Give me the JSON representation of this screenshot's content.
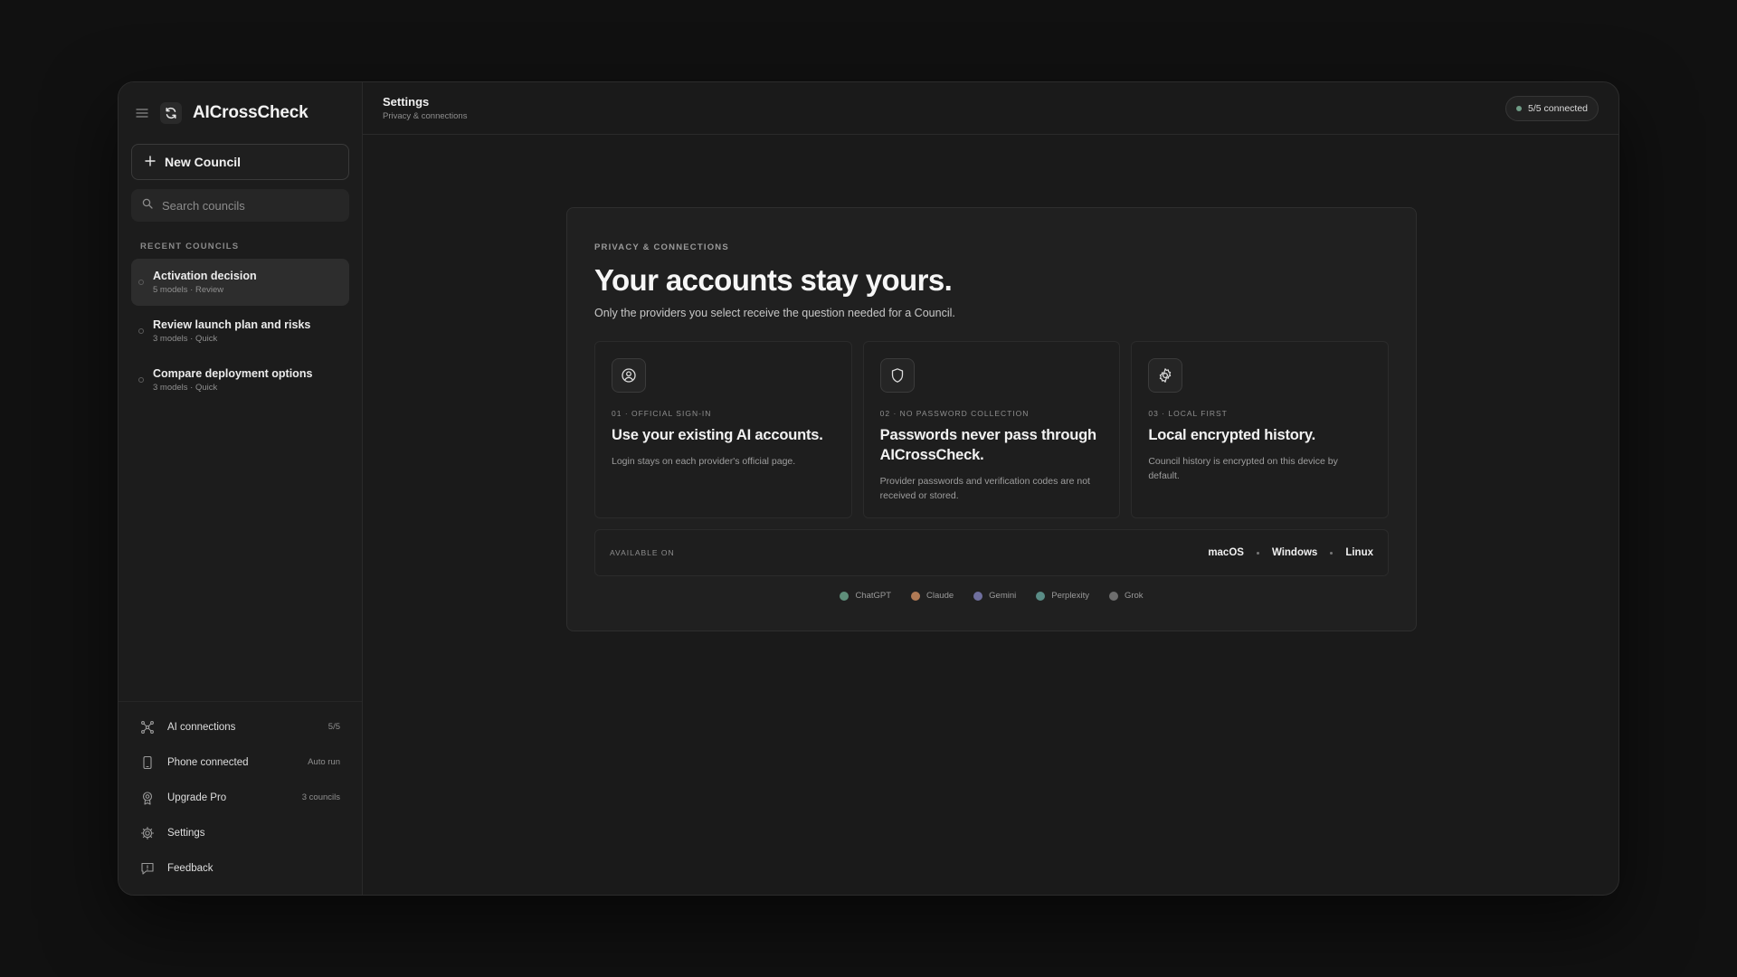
{
  "app": {
    "title": "AICrossCheck"
  },
  "sidebar": {
    "new_council_label": "New Council",
    "search_placeholder": "Search councils",
    "recent_label": "RECENT COUNCILS",
    "recent": [
      {
        "name": "Activation decision",
        "meta": "5 models · Review",
        "active": true
      },
      {
        "name": "Review launch plan and risks",
        "meta": "3 models · Quick",
        "active": false
      },
      {
        "name": "Compare deployment options",
        "meta": "3 models · Quick",
        "active": false
      }
    ],
    "bottom": [
      {
        "label": "AI connections",
        "aux": "5/5",
        "icon": "network-icon"
      },
      {
        "label": "Phone connected",
        "aux": "Auto run",
        "icon": "phone-icon"
      },
      {
        "label": "Upgrade Pro",
        "aux": "3 councils",
        "icon": "badge-icon"
      },
      {
        "label": "Settings",
        "aux": "",
        "icon": "gear-icon"
      },
      {
        "label": "Feedback",
        "aux": "",
        "icon": "feedback-icon"
      }
    ]
  },
  "topbar": {
    "title": "Settings",
    "subtitle": "Privacy & connections",
    "status": "5/5 connected",
    "status_color": "#6f9c86"
  },
  "main": {
    "eyebrow": "PRIVACY & CONNECTIONS",
    "headline": "Your accounts stay yours.",
    "subline": "Only the providers you select receive the question needed for a Council.",
    "features": [
      {
        "tag": "01 · OFFICIAL SIGN-IN",
        "title": "Use your existing AI accounts.",
        "desc": "Login stays on each provider's official page.",
        "icon": "user-circle-icon"
      },
      {
        "tag": "02 · NO PASSWORD COLLECTION",
        "title": "Passwords never pass through AICrossCheck.",
        "desc": "Provider passwords and verification codes are not received or stored.",
        "icon": "shield-icon"
      },
      {
        "tag": "03 · LOCAL FIRST",
        "title": "Local encrypted history.",
        "desc": "Council history is encrypted on this device by default.",
        "icon": "gear-icon"
      }
    ],
    "available_label": "AVAILABLE ON",
    "platforms": [
      "macOS",
      "Windows",
      "Linux"
    ],
    "providers": [
      {
        "name": "ChatGPT",
        "color": "#5f8f7b"
      },
      {
        "name": "Claude",
        "color": "#b07a55"
      },
      {
        "name": "Gemini",
        "color": "#6f6f9e"
      },
      {
        "name": "Perplexity",
        "color": "#5a8c86"
      },
      {
        "name": "Grok",
        "color": "#6e6e6e"
      }
    ]
  }
}
